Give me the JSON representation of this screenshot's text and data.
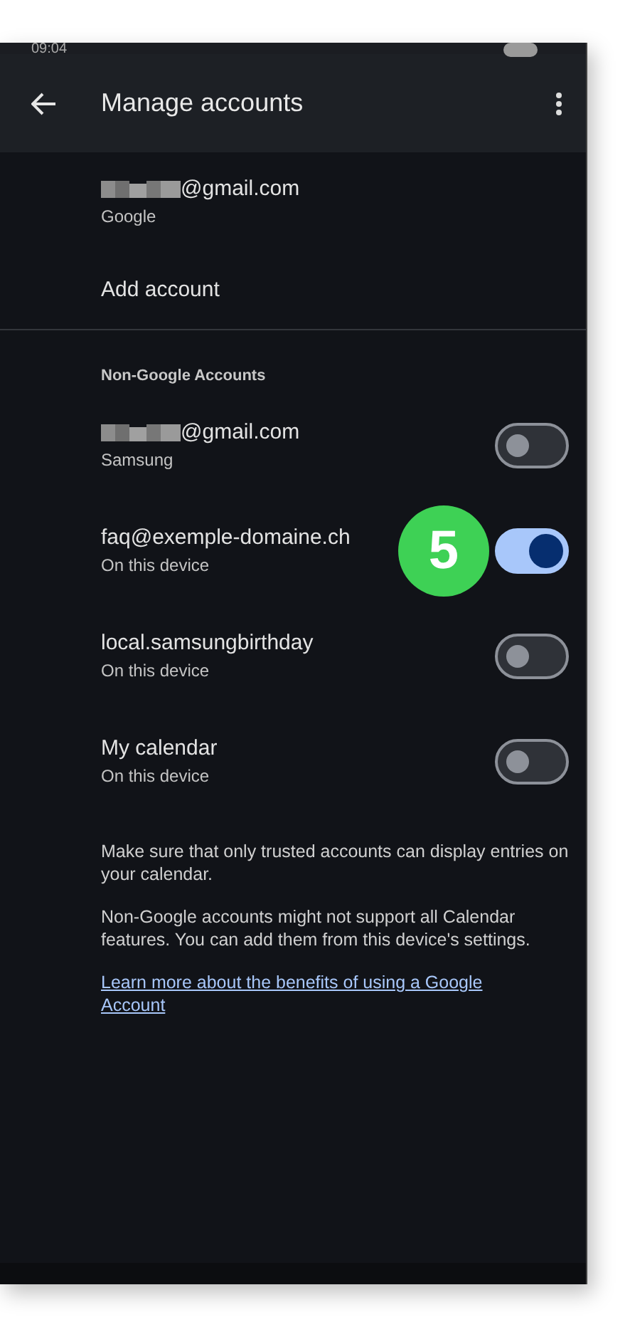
{
  "status_bar": {
    "time": "09:04"
  },
  "app_bar": {
    "title": "Manage accounts"
  },
  "google_account": {
    "email": "@gmail.com",
    "redacted": true,
    "provider": "Google"
  },
  "add_account": {
    "label": "Add account"
  },
  "section": {
    "title": "Non-Google Accounts"
  },
  "accounts": [
    {
      "name": "@gmail.com",
      "redacted": true,
      "source": "Samsung",
      "on": false
    },
    {
      "name": "faq@exemple-domaine.ch",
      "redacted": false,
      "source": "On this device",
      "on": true,
      "step": "5"
    },
    {
      "name": "local.samsungbirthday",
      "redacted": false,
      "source": "On this device",
      "on": false
    },
    {
      "name": "My calendar",
      "redacted": false,
      "source": "On this device",
      "on": false
    }
  ],
  "notes": [
    "Make sure that only trusted accounts can display entries on your calendar.",
    "Non-Google accounts might not support all Calendar features. You can add them from this device's settings."
  ],
  "link": "Learn more about the benefits of using a Google Account"
}
